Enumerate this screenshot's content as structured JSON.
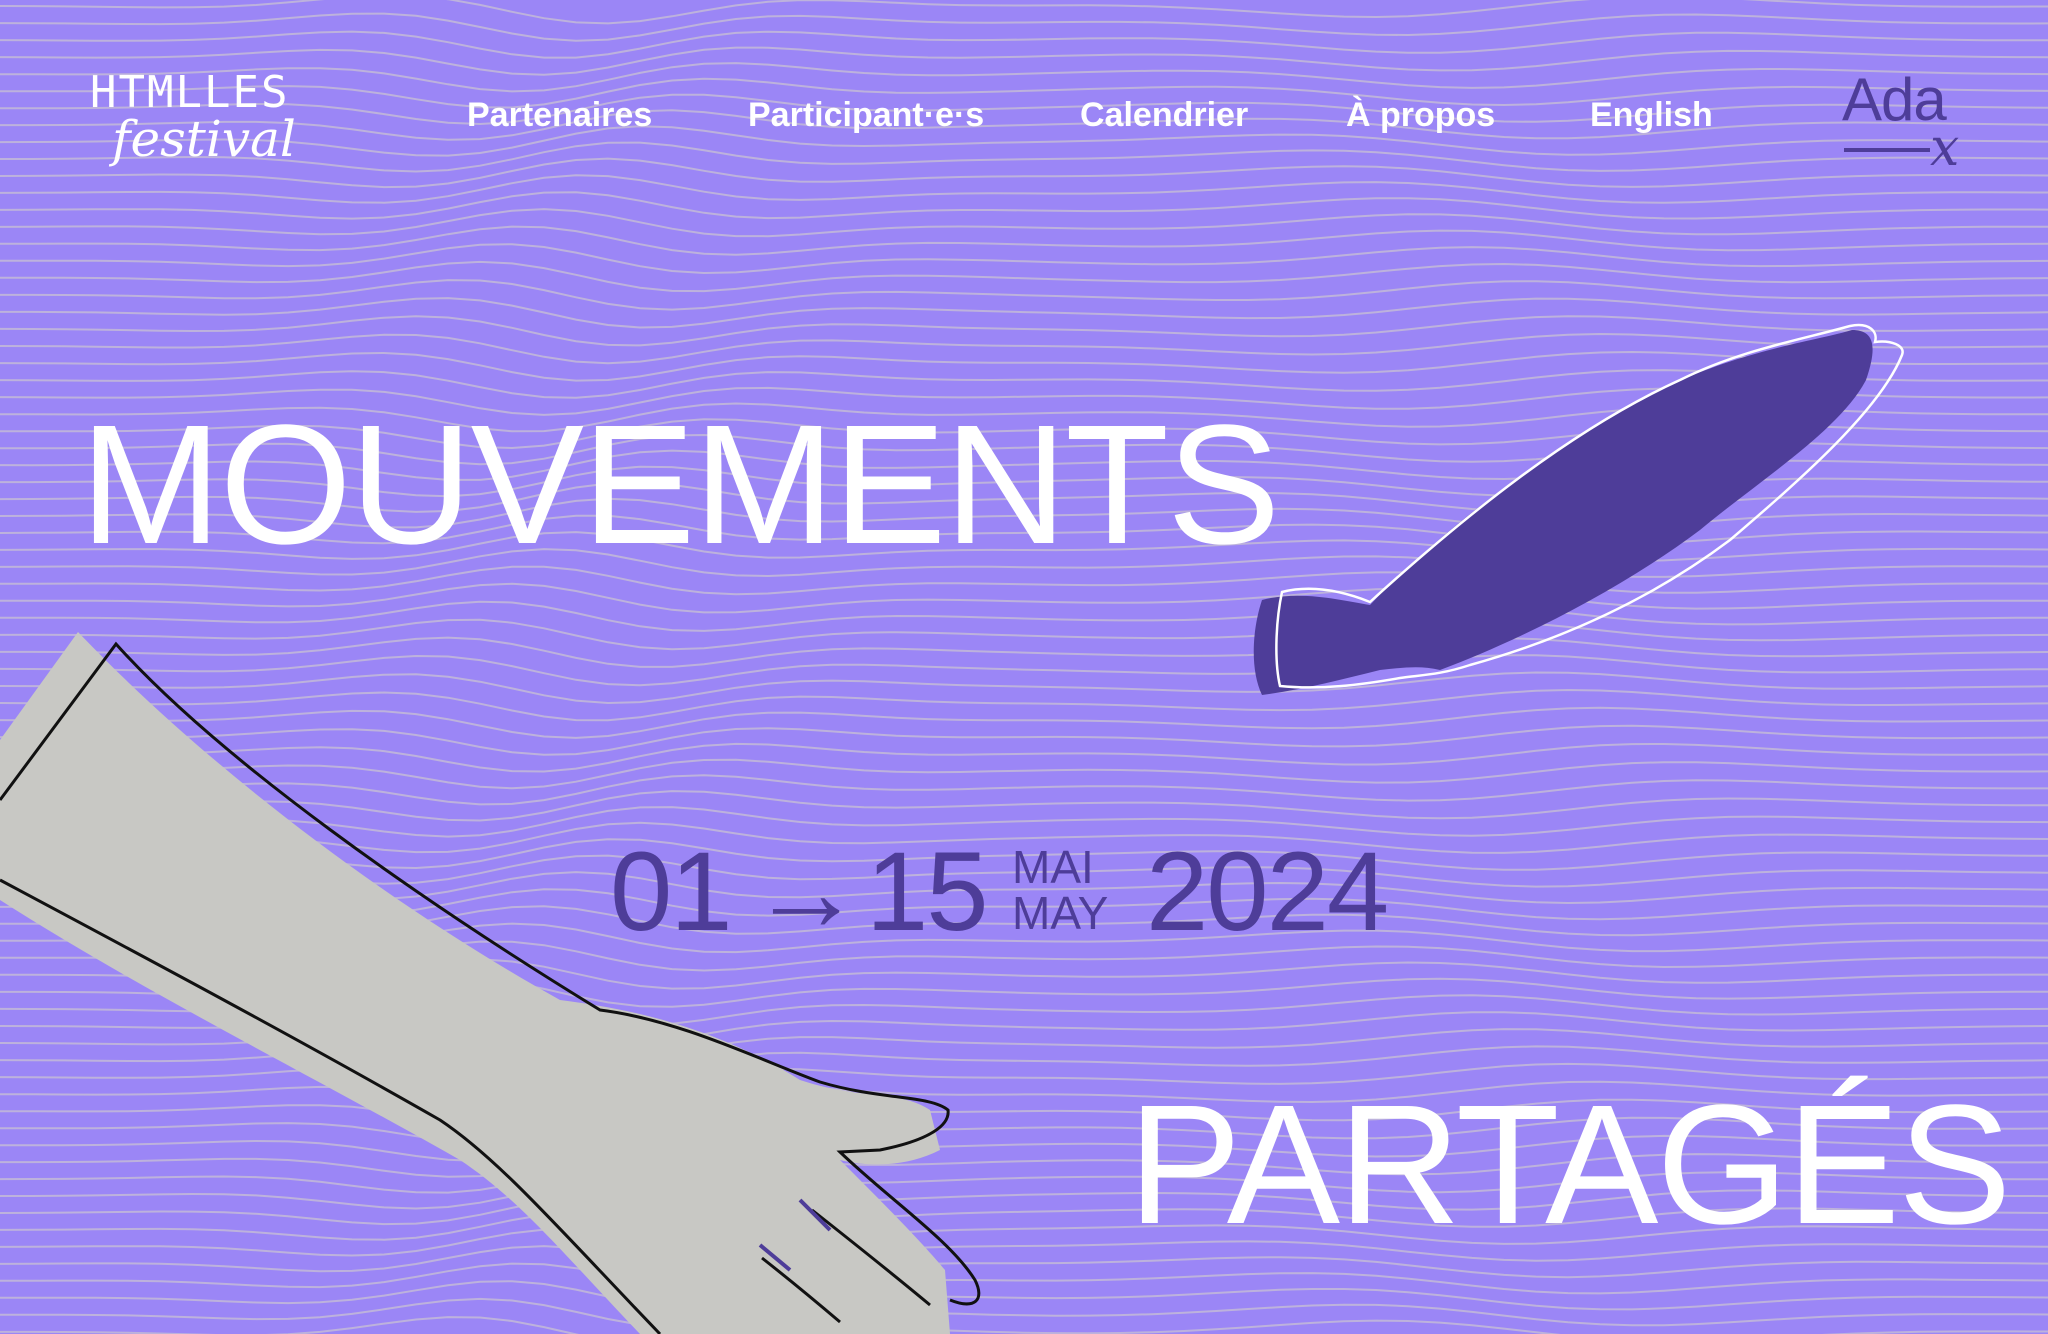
{
  "brand": {
    "logo_line1": "HTMLLES",
    "logo_line2": "festival",
    "partner_logo": "Ada",
    "partner_logo_sub": "x"
  },
  "nav": {
    "items": [
      {
        "label": "Partenaires"
      },
      {
        "label": "Participant·e·s"
      },
      {
        "label": "Calendrier"
      },
      {
        "label": "À propos"
      },
      {
        "label": "English"
      }
    ]
  },
  "hero": {
    "title_line1": "MOUVEMENTS",
    "title_line2": "PARTAGÉS",
    "date_start": "01",
    "date_arrow": "→",
    "date_end": "15",
    "month_fr": "MAI",
    "month_en": "MAY",
    "year": "2024"
  },
  "colors": {
    "background": "#9b86f6",
    "accent_dark": "#4e3d99",
    "text_light": "#ffffff",
    "hand_fill": "#c8c8c4",
    "lines": "#bdb2dc"
  },
  "icons": {
    "illustration_left": "reaching-arm-illustration",
    "illustration_right": "fish-shaped-shadow-illustration"
  }
}
